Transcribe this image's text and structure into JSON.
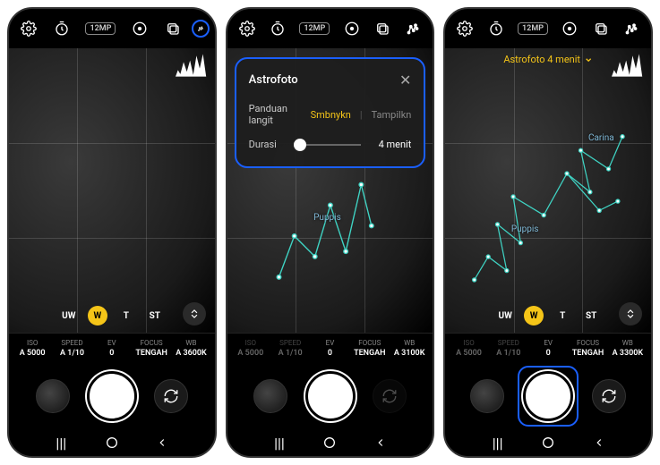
{
  "toolbar": {
    "resolution_badge": "12MP"
  },
  "astro_chip": {
    "label": "Astrofoto 4 menit"
  },
  "popup": {
    "title": "Astrofoto",
    "guide_label": "Panduan langit",
    "guide_opt_hide": "Smbnykn",
    "guide_opt_show": "Tampilkn",
    "duration_label": "Durasi",
    "duration_value": "4 menit"
  },
  "zoom": {
    "uw": "UW",
    "w": "W",
    "t": "T",
    "st": "ST"
  },
  "settings": {
    "iso_label": "ISO",
    "iso_value": "A 5000",
    "speed_label": "SPEED",
    "speed_value": "A 1/10",
    "ev_label": "EV",
    "ev_value": "0",
    "focus_label": "FOCUS",
    "focus_value": "TENGAH",
    "wb_label": "WB",
    "wb_value_1": "A 3600K",
    "wb_value_2": "A 3100K",
    "wb_value_3": "A 3300K"
  },
  "constellations": {
    "puppis": "Puppis",
    "carina": "Carina"
  }
}
